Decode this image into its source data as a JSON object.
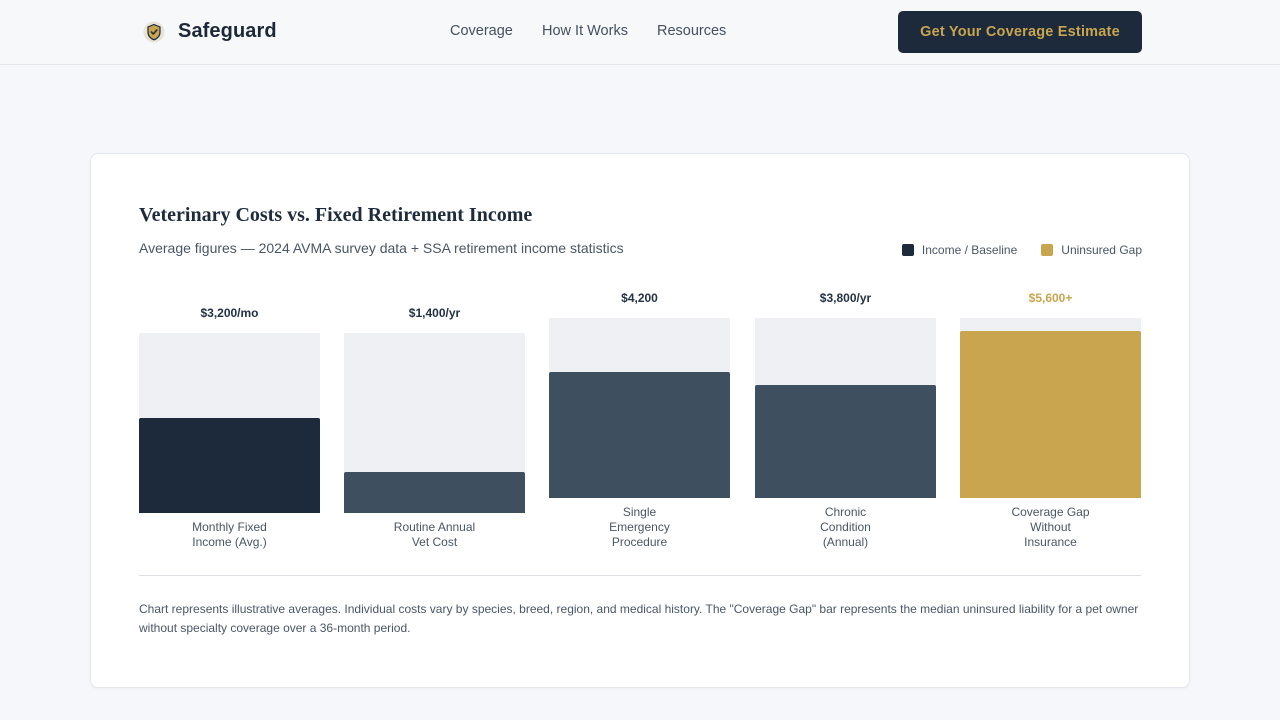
{
  "header": {
    "brand_name": "Safeguard",
    "nav": [
      {
        "label": "Coverage"
      },
      {
        "label": "How It Works"
      },
      {
        "label": "Resources"
      }
    ],
    "cta_label": "Get Your Coverage Estimate"
  },
  "colors": {
    "navy": "#1c2a3b",
    "slate": "#3e4f60",
    "gold": "#c8a54e",
    "track": "#eef0f3"
  },
  "chart_data": {
    "type": "bar",
    "title": "Veterinary Costs vs. Fixed Retirement Income",
    "subtitle": "Average figures — 2024 AVMA survey data + SSA retirement income statistics",
    "legend": [
      {
        "label": "Income / Baseline",
        "color": "#1c2a3b"
      },
      {
        "label": "Uninsured Gap",
        "color": "#c8a54e"
      }
    ],
    "legend_position": "top-right",
    "categories": [
      "Monthly Fixed\nIncome (Avg.)",
      "Routine Annual\nVet Cost",
      "Single\nEmergency\nProcedure",
      "Chronic\nCondition\n(Annual)",
      "Coverage Gap\nWithout\nInsurance"
    ],
    "value_labels": [
      "$3,200/mo",
      "$1,400/yr",
      "$4,200",
      "$3,800/yr",
      "$5,600+"
    ],
    "values": [
      3200,
      1400,
      4200,
      3800,
      5600
    ],
    "fill_fraction": [
      0.53,
      0.23,
      0.7,
      0.63,
      0.93
    ],
    "colors": [
      "#1c2a3b",
      "#3e4f60",
      "#3e4f60",
      "#3e4f60",
      "#c8a54e"
    ],
    "grid": false
  },
  "footnote": "Chart represents illustrative averages. Individual costs vary by species, breed, region, and medical history. The \"Coverage Gap\" bar represents the median uninsured liability for a pet owner without specialty coverage over a 36-month period."
}
